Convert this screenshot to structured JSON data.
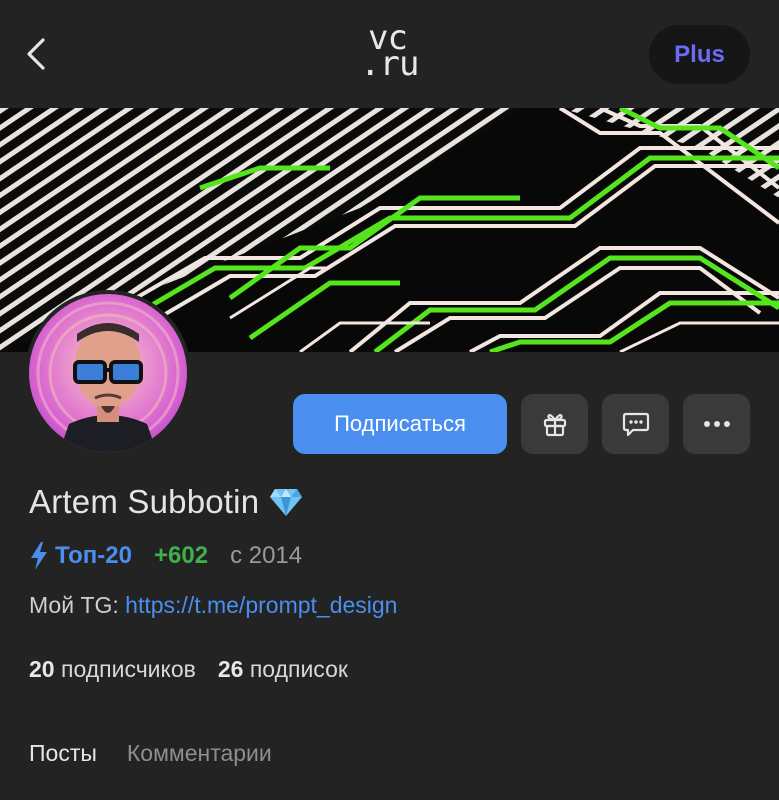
{
  "header": {
    "logo_line1": "vc",
    "logo_line2": ".ru",
    "plus_label": "Plus"
  },
  "profile": {
    "name": "Artem Subbotin",
    "top_label": "Топ-20",
    "rating": "+602",
    "since": "с 2014",
    "bio_prefix": "Мой TG: ",
    "bio_link": "https://t.me/prompt_design",
    "followers_count": "20",
    "followers_label": " подписчиков",
    "following_count": "26",
    "following_label": " подписок"
  },
  "actions": {
    "subscribe_label": "Подписаться"
  },
  "tabs": [
    {
      "label": "Посты",
      "active": true
    },
    {
      "label": "Комментарии",
      "active": false
    }
  ],
  "icons": {
    "back": "chevron-left-icon",
    "gift": "gift-icon",
    "message": "message-icon",
    "more": "more-icon",
    "verified": "diamond-icon",
    "top": "lightning-icon"
  },
  "colors": {
    "background": "#232323",
    "accent": "#4a8ef0",
    "plus_text": "#6b6cf6",
    "rating": "#3fb14b",
    "button_bg": "#3a3a3a",
    "cover_green": "#55e51d"
  }
}
